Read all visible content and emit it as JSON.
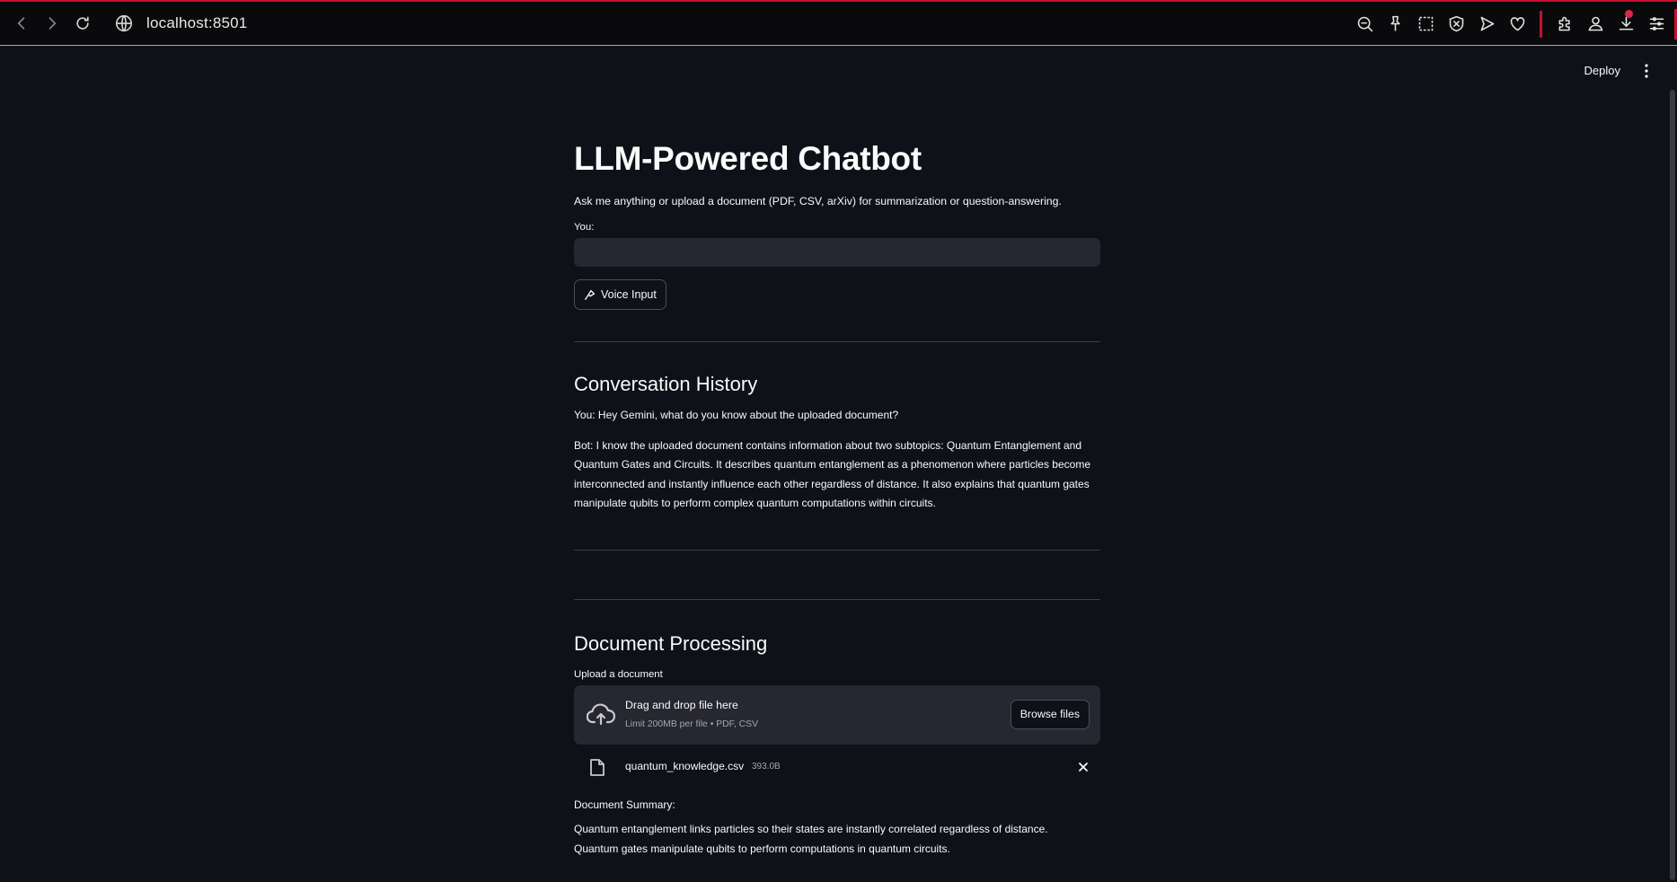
{
  "browser": {
    "url": "localhost:8501"
  },
  "header": {
    "deploy_label": "Deploy"
  },
  "main": {
    "title": "LLM-Powered Chatbot",
    "caption": "Ask me anything or upload a document (PDF, CSV, arXiv) for summarization or question-answering.",
    "input_label": "You:",
    "input_value": "",
    "voice_button_label": "Voice Input"
  },
  "history": {
    "heading": "Conversation History",
    "user_message": "You: Hey Gemini, what do you know about the uploaded document?",
    "bot_message": "Bot: I know the uploaded document contains information about two subtopics: Quantum Entanglement and Quantum Gates and Circuits. It describes quantum entanglement as a phenomenon where particles become interconnected and instantly influence each other regardless of distance. It also explains that quantum gates manipulate qubits to perform complex quantum computations within circuits."
  },
  "documents": {
    "heading": "Document Processing",
    "uploader_label": "Upload a document",
    "drop_title": "Drag and drop file here",
    "drop_limits": "Limit 200MB per file • PDF, CSV",
    "browse_label": "Browse files",
    "file": {
      "name": "quantum_knowledge.csv",
      "size": "393.0B"
    },
    "summary_label": "Document Summary:",
    "summary_line1": "Quantum entanglement links particles so their states are instantly correlated regardless of distance.",
    "summary_line2": "Quantum gates manipulate qubits to perform computations in quantum circuits."
  },
  "colors": {
    "background": "#0e1117",
    "input_bg": "#262730",
    "browser_accent": "#c8102e"
  },
  "icons": [
    "back-icon",
    "forward-icon",
    "reload-icon",
    "globe-icon",
    "zoom-out-icon",
    "pin-icon",
    "screenshot-icon",
    "shield-icon",
    "send-icon",
    "heart-icon",
    "extensions-icon",
    "profile-icon",
    "download-icon",
    "menu-icon",
    "kebab-icon",
    "microphone-icon",
    "cloud-upload-icon",
    "file-icon",
    "close-icon"
  ]
}
